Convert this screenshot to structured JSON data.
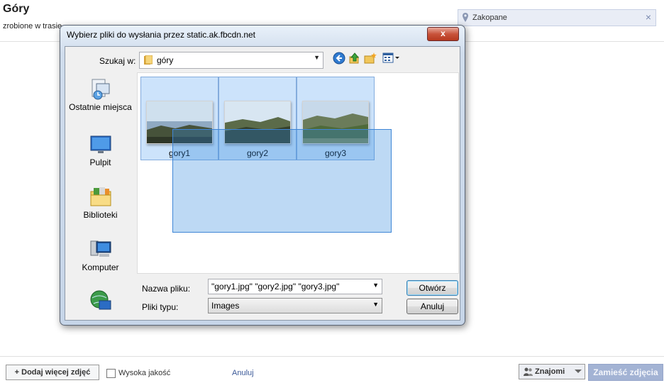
{
  "album": {
    "title": "Góry",
    "subtitle": "zrobione w trasie"
  },
  "location": {
    "value": "Zakopane",
    "clear_glyph": "×",
    "pin_icon": "location-pin-icon"
  },
  "dialog": {
    "title": "Wybierz pliki do wysłania przez static.ak.fbcdn.net",
    "close_glyph": "x",
    "look_in_label": "Szukaj w:",
    "look_in_value": "góry",
    "places": [
      {
        "label": "Ostatnie miejsca",
        "icon": "recent-places-icon"
      },
      {
        "label": "Pulpit",
        "icon": "desktop-icon"
      },
      {
        "label": "Biblioteki",
        "icon": "libraries-icon"
      },
      {
        "label": "Komputer",
        "icon": "computer-icon"
      },
      {
        "label": "",
        "icon": "network-icon"
      }
    ],
    "files": [
      {
        "name": "gory1",
        "selected": true
      },
      {
        "name": "gory2",
        "selected": true
      },
      {
        "name": "gory3",
        "selected": true
      }
    ],
    "file_name_label": "Nazwa pliku:",
    "file_name_value": "\"gory1.jpg\" \"gory2.jpg\" \"gory3.jpg\"",
    "file_type_label": "Pliki typu:",
    "file_type_value": "Images",
    "open_label": "Otwórz",
    "cancel_label": "Anuluj"
  },
  "footer": {
    "add_more_label": "+ Dodaj więcej zdjęć",
    "high_quality_label": "Wysoka jakość",
    "high_quality_checked": false,
    "cancel_label": "Anuluj",
    "audience_label": "Znajomi",
    "post_label": "Zamieść zdjęcia"
  },
  "colors": {
    "selection": "#cce3fb",
    "marquee": "#3388dd",
    "link": "#3b5998",
    "post_button_disabled": "#a3b3d4"
  }
}
